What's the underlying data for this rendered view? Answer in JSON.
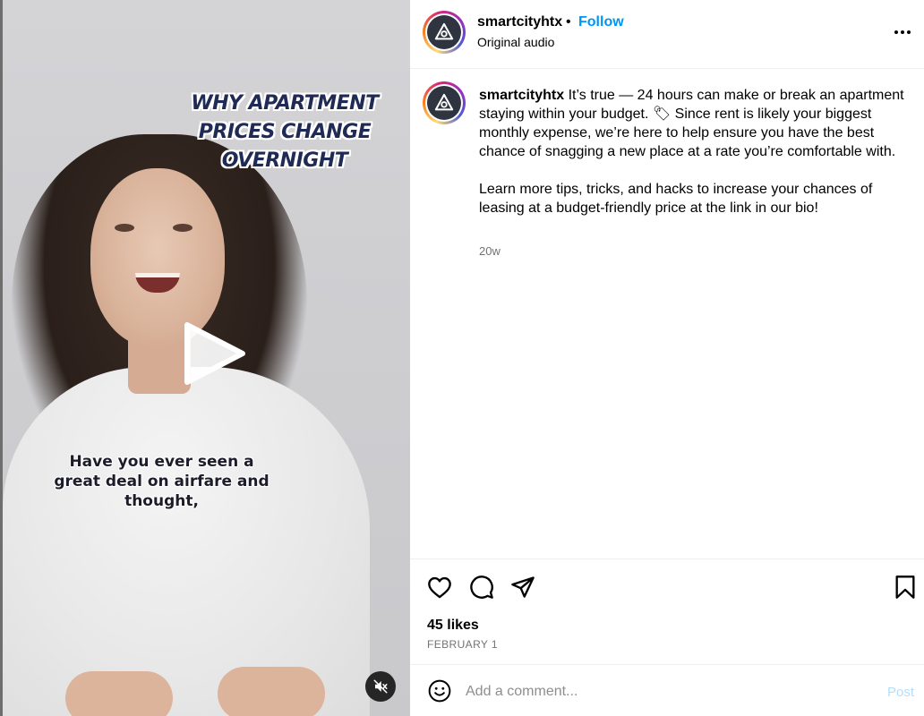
{
  "video": {
    "title_lines": [
      "WHY APARTMENT",
      "PRICES CHANGE",
      "OVERNIGHT"
    ],
    "caption_lines": [
      "Have you ever seen a",
      "great deal on airfare and",
      "thought,"
    ]
  },
  "header": {
    "username": "smartcityhtx",
    "separator": "•",
    "follow_label": "Follow",
    "audio_label": "Original audio"
  },
  "caption": {
    "username": "smartcityhtx",
    "paragraph_1": "It’s true — 24 hours can make or break an apartment staying within your budget. 🏷 Since rent is likely your biggest monthly expense, we’re here to help ensure you have the best chance of snagging a new place at a rate you’re comfortable with.",
    "paragraph_2": "Learn more tips, tricks, and hacks to increase your chances of leasing at a budget-friendly price at the link in our bio!",
    "time_ago": "20w"
  },
  "stats": {
    "likes": "45 likes",
    "date": "FEBRUARY 1"
  },
  "comment": {
    "placeholder": "Add a comment...",
    "post_label": "Post"
  },
  "colors": {
    "accent": "#0095f6",
    "post_disabled": "#b2dffc",
    "muted_text": "#737373",
    "title_text": "#1f2a55"
  },
  "icons": {
    "like": "heart-icon",
    "comment": "comment-icon",
    "share": "send-icon",
    "save": "bookmark-icon",
    "more": "more-dots-icon",
    "emoji": "emoji-icon",
    "play": "play-icon",
    "mute": "muted-speaker-icon"
  }
}
